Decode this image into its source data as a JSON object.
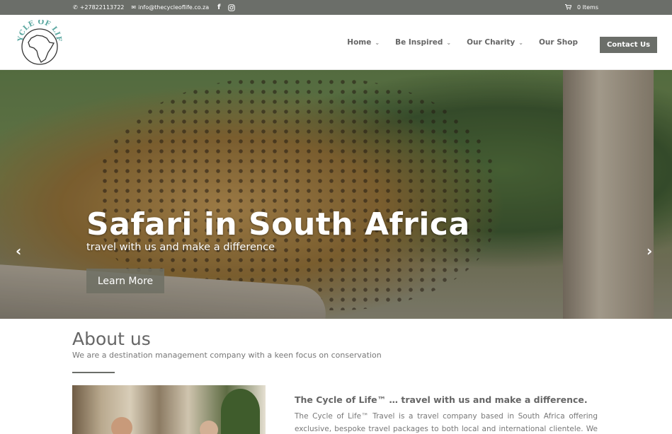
{
  "topbar": {
    "phone": "+27822113722",
    "email": "info@thecycleoflife.co.za",
    "facebook_icon": "facebook-icon",
    "instagram_icon": "instagram-icon",
    "cart": "0 Items"
  },
  "header": {
    "logo_text": "CYCLE OF LIFE",
    "nav": [
      {
        "label": "Home",
        "has_dropdown": true
      },
      {
        "label": "Be Inspired",
        "has_dropdown": true
      },
      {
        "label": "Our Charity",
        "has_dropdown": true
      },
      {
        "label": "Our Shop",
        "has_dropdown": false
      }
    ],
    "contact_label": "Contact Us"
  },
  "hero": {
    "title": "Safari in South Africa",
    "subtitle": "travel with us and make a difference",
    "button": "Learn More",
    "prev_icon": "chevron-left-icon",
    "next_icon": "chevron-right-icon",
    "slides": 5,
    "active_slide": 1
  },
  "about": {
    "title": "About us",
    "subtitle": "We are a destination management company with a keen focus on conservation",
    "heading": "The Cycle of Life™ … travel with us and make a difference.",
    "text": "The Cycle of Life™ Travel is a travel company based in South Africa offering exclusive, bespoke travel packages to both local and international clientele. We help create once in"
  },
  "colors": {
    "accent": "#6b6e69",
    "text": "#666666"
  }
}
